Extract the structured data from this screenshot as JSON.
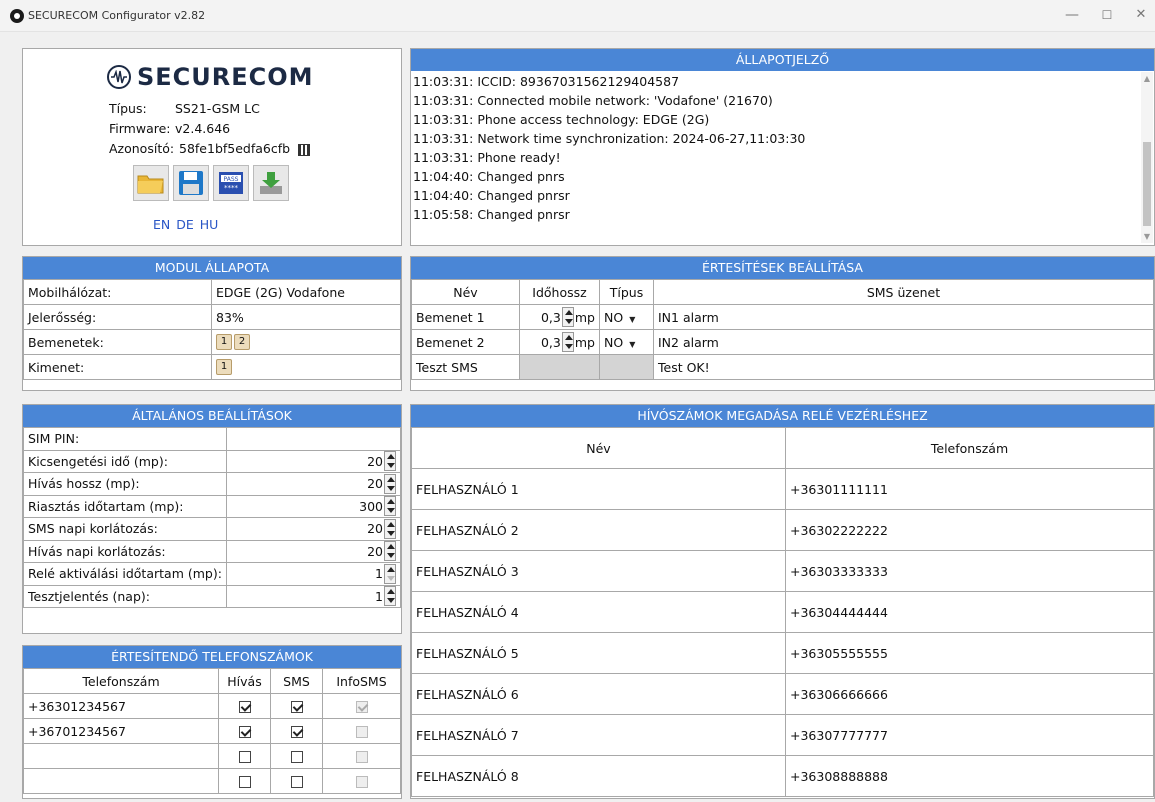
{
  "window": {
    "title": "SECURECOM Configurator v2.82",
    "min": "—",
    "max": "☐",
    "close": "✕"
  },
  "device": {
    "logo_text": "SECURECOM",
    "type_label": "Típus:",
    "type_value": "SS21-GSM LC",
    "firmware_label": "Firmware:",
    "firmware_value": "v2.4.646",
    "id_label": "Azonosító:",
    "id_value": "58fe1bf5edfa6cfb",
    "langs": [
      "EN",
      "DE",
      "HU"
    ]
  },
  "log": {
    "title": "ÁLLAPOTJELZŐ",
    "lines": [
      "11:03:31: ICCID: 89367031562129404587",
      "11:03:31: Connected mobile network: 'Vodafone' (21670)",
      "11:03:31: Phone access technology: EDGE (2G)",
      "11:03:31: Network time synchronization: 2024-06-27,11:03:30",
      "11:03:31: Phone ready!",
      "11:04:40: Changed pnrs",
      "11:04:40: Changed pnrsr",
      "11:05:58: Changed pnrsr"
    ]
  },
  "module": {
    "title": "MODUL ÁLLAPOTA",
    "network_label": "Mobilhálózat:",
    "network_value": "EDGE (2G) Vodafone",
    "signal_label": "Jelerősség:",
    "signal_value": "83%",
    "inputs_label": "Bemenetek:",
    "inputs": [
      "1",
      "2"
    ],
    "output_label": "Kimenet:",
    "outputs": [
      "1"
    ]
  },
  "notif": {
    "title": "ÉRTESÍTÉSEK BEÁLLÍTÁSA",
    "h_name": "Név",
    "h_time": "Időhossz",
    "h_type": "Típus",
    "h_sms": "SMS üzenet",
    "rows": [
      {
        "name": "Bemenet 1",
        "time": "0,3",
        "unit": "mp",
        "type": "NO",
        "sms": "IN1 alarm"
      },
      {
        "name": "Bemenet 2",
        "time": "0,3",
        "unit": "mp",
        "type": "NO",
        "sms": "IN2 alarm"
      },
      {
        "name": "Teszt SMS",
        "sms": "Test OK!"
      }
    ]
  },
  "general": {
    "title": "ÁLTALÁNOS BEÁLLÍTÁSOK",
    "rows": [
      {
        "label": "SIM PIN:",
        "value": ""
      },
      {
        "label": "Kicsengetési idő (mp):",
        "value": "20"
      },
      {
        "label": "Hívás hossz (mp):",
        "value": "20"
      },
      {
        "label": "Riasztás időtartam (mp):",
        "value": "300"
      },
      {
        "label": "SMS napi korlátozás:",
        "value": "20"
      },
      {
        "label": "Hívás napi korlátozás:",
        "value": "20"
      },
      {
        "label": "Relé aktiválási időtartam (mp):",
        "value": "1"
      },
      {
        "label": "Tesztjelentés (nap):",
        "value": "1"
      }
    ]
  },
  "phones": {
    "title": "ÉRTESÍTENDŐ TELEFONSZÁMOK",
    "h_num": "Telefonszám",
    "h_call": "Hívás",
    "h_sms": "SMS",
    "h_info": "InfoSMS",
    "rows": [
      {
        "num": "+36301234567",
        "call": true,
        "sms": true,
        "info": true
      },
      {
        "num": "+36701234567",
        "call": true,
        "sms": true,
        "info": false
      },
      {
        "num": "",
        "call": false,
        "sms": false,
        "info": false
      },
      {
        "num": "",
        "call": false,
        "sms": false,
        "info": false
      }
    ]
  },
  "relay": {
    "title": "HÍVÓSZÁMOK MEGADÁSA RELÉ VEZÉRLÉSHEZ",
    "h_name": "Név",
    "h_phone": "Telefonszám",
    "rows": [
      {
        "name": "FELHASZNÁLÓ 1",
        "phone": "+36301111111"
      },
      {
        "name": "FELHASZNÁLÓ 2",
        "phone": "+36302222222"
      },
      {
        "name": "FELHASZNÁLÓ 3",
        "phone": "+36303333333"
      },
      {
        "name": "FELHASZNÁLÓ 4",
        "phone": "+36304444444"
      },
      {
        "name": "FELHASZNÁLÓ 5",
        "phone": "+36305555555"
      },
      {
        "name": "FELHASZNÁLÓ 6",
        "phone": "+36306666666"
      },
      {
        "name": "FELHASZNÁLÓ 7",
        "phone": "+36307777777"
      },
      {
        "name": "FELHASZNÁLÓ 8",
        "phone": "+36308888888"
      }
    ]
  }
}
